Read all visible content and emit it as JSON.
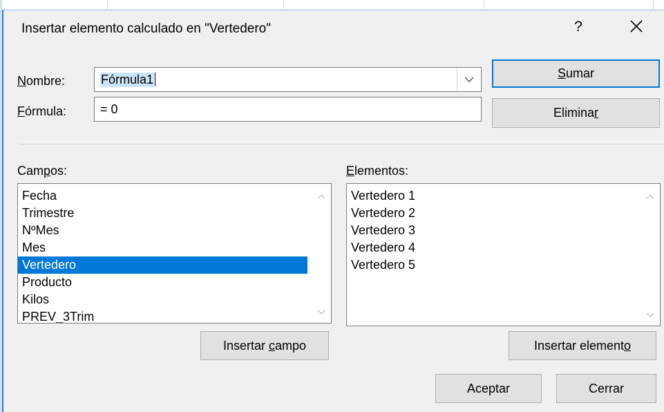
{
  "dialog": {
    "title": "Insertar elemento calculado en \"Vertedero\"",
    "help_label": "?",
    "close_icon": "close-icon"
  },
  "nombre": {
    "label_accel": "N",
    "label_rest": "ombre:",
    "value": "Fórmula1"
  },
  "formula": {
    "label_accel": "F",
    "label_rest": "órmula:",
    "value": "= 0"
  },
  "buttons": {
    "sumar_accel": "S",
    "sumar_rest": "umar",
    "eliminar_pre": "Elimina",
    "eliminar_accel": "r",
    "insertar_campo_pre": "Insertar ",
    "insertar_campo_accel": "c",
    "insertar_campo_rest": "ampo",
    "insertar_elemento_pre": "Insertar element",
    "insertar_elemento_accel": "o",
    "aceptar": "Aceptar",
    "cerrar": "Cerrar"
  },
  "campos": {
    "label_pre": "Cam",
    "label_accel": "p",
    "label_rest": "os:",
    "items": [
      "Fecha",
      "Trimestre",
      "NºMes",
      "Mes",
      "Vertedero",
      "Producto",
      "Kilos",
      "PREV_3Trim"
    ],
    "selected": "Vertedero"
  },
  "elementos": {
    "label_accel": "E",
    "label_rest": "lementos:",
    "items": [
      "Vertedero 1",
      "Vertedero 2",
      "Vertedero 3",
      "Vertedero 4",
      "Vertedero 5"
    ]
  },
  "colors": {
    "accent": "#0078d7",
    "dialog_bg": "#f0f0f0",
    "button_bg": "#e1e1e1"
  }
}
